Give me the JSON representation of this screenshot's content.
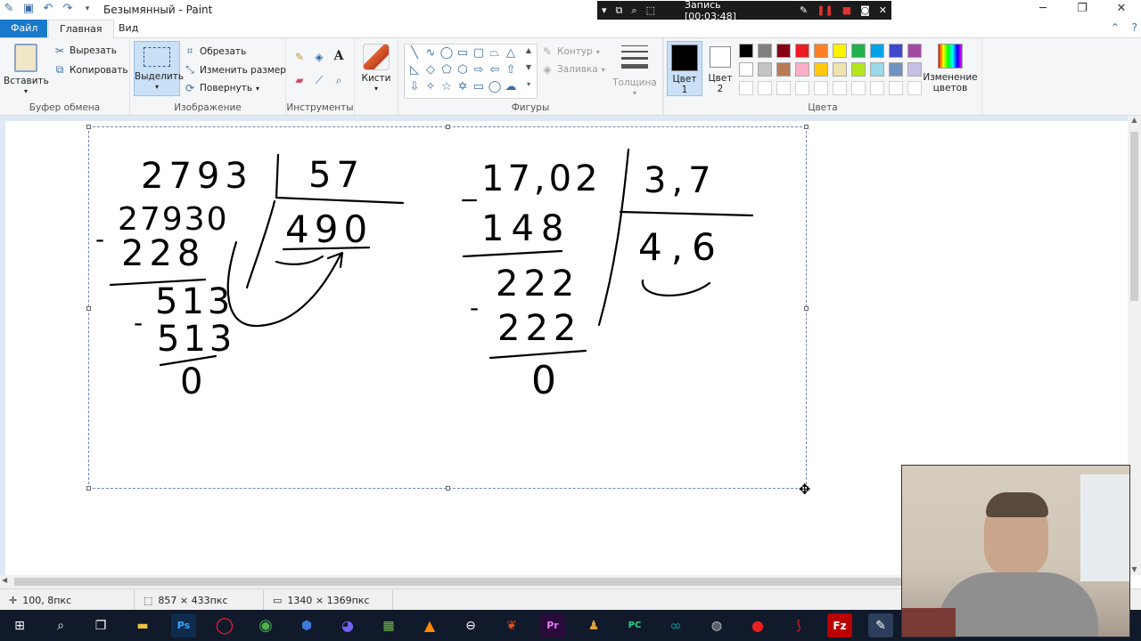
{
  "window": {
    "title": "Безымянный - Paint"
  },
  "recorder": {
    "label": "Запись [00:03:48]"
  },
  "menu": {
    "file": "Файл",
    "home": "Главная",
    "view": "Вид"
  },
  "clipboard": {
    "paste": "Вставить",
    "cut": "Вырезать",
    "copy": "Копировать",
    "label": "Буфер обмена"
  },
  "image": {
    "select": "Выделить",
    "crop": "Обрезать",
    "resize": "Изменить размер",
    "rotate": "Повернуть",
    "label": "Изображение"
  },
  "tools": {
    "label": "Инструменты",
    "brushes": "Кисти"
  },
  "shapes": {
    "outline": "Контур",
    "fill": "Заливка",
    "label": "Фигуры"
  },
  "size": {
    "label": "Толщина"
  },
  "colors": {
    "color1": "Цвет 1",
    "color2": "Цвет 2",
    "edit": "Изменение цветов",
    "label": "Цвета",
    "primary": "#000000",
    "secondary": "#ffffff",
    "palette_row1": [
      "#000000",
      "#7f7f7f",
      "#880015",
      "#ed1c24",
      "#ff7f27",
      "#fff200",
      "#22b14c",
      "#00a2e8",
      "#3f48cc",
      "#a349a4"
    ],
    "palette_row2": [
      "#ffffff",
      "#c3c3c3",
      "#b97a57",
      "#ffaec9",
      "#ffc90e",
      "#efe4b0",
      "#b5e61d",
      "#99d9ea",
      "#7092be",
      "#c8bfe7"
    ],
    "palette_row3": [
      "#ffffff",
      "#ffffff",
      "#ffffff",
      "#ffffff",
      "#ffffff",
      "#ffffff",
      "#ffffff",
      "#ffffff",
      "#ffffff",
      "#ffffff"
    ]
  },
  "drawing": {
    "left": {
      "dividend": "2793",
      "divisor": "57",
      "step1": "27930",
      "sub1": "228",
      "rem1": "513",
      "sub2": "513",
      "final": "0",
      "quotient": "490",
      "minus": "-"
    },
    "right": {
      "dividend": "17,02",
      "divisor": "3,7",
      "sub1": "148",
      "rem1": "222",
      "sub2": "222",
      "final": "0",
      "quotient": "4,6",
      "minus": "-"
    }
  },
  "status": {
    "cursor": "100, 8пкс",
    "selection": "857 × 433пкс",
    "canvas": "1340 × 1369пкс"
  }
}
